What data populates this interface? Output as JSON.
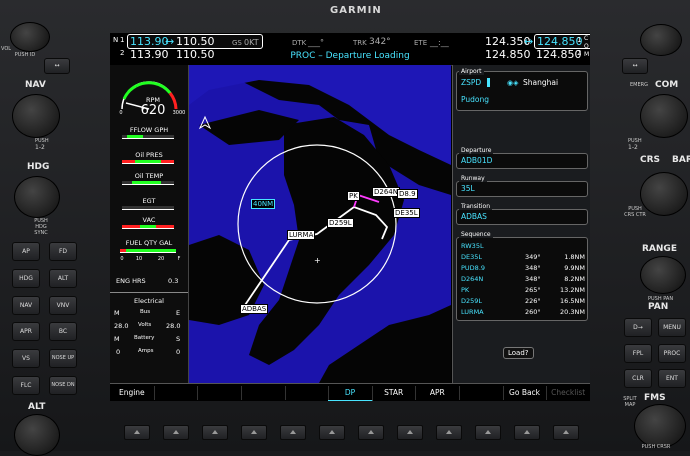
{
  "brand": "GARMIN",
  "nav": {
    "n1_label": "N",
    "n1_num": "1",
    "n2_num": "2",
    "n1_active": "113.90",
    "n1_arrow": "↔",
    "n1_standby": "110.50",
    "n2_active": "113.90",
    "n2_standby": "110.50"
  },
  "status": {
    "gs_label": "GS",
    "gs_value": "0KT",
    "dtk_label": "DTK",
    "dtk_value": "___°",
    "trk_label": "TRK",
    "trk_value": "342°",
    "ete_label": "ETE",
    "ete_value": "__:__"
  },
  "com": {
    "c1_active": "124.350",
    "c1_arrow": "↔",
    "c1_standby": "124.850",
    "c2_active": "124.850",
    "c2_standby": "124.850",
    "c1_num": "1",
    "c2_num": "2",
    "side_c": "C",
    "side_o": "O",
    "side_m": "M"
  },
  "page_title": "PROC – Departure Loading",
  "eis": {
    "rpm_label": "RPM",
    "rpm_value": "620",
    "rpm_min": "0",
    "rpm_max": "3000",
    "fflow": "FFLOW GPH",
    "oil_pres": "Oil PRES",
    "oil_temp": "Oil TEMP",
    "egt": "EGT",
    "vac": "VAC",
    "fuel_qty": "FUEL QTY GAL",
    "fuel_0": "0",
    "fuel_10": "10",
    "fuel_20": "20",
    "fuel_f": "F",
    "eng_hrs_label": "ENG HRS",
    "eng_hrs_value": "0.3",
    "electrical": "Electrical",
    "m1": "M",
    "bus": "Bus",
    "e1": "E",
    "volts_m": "28.0",
    "volts": "Volts",
    "volts_e": "28.0",
    "m2": "M",
    "battery": "Battery",
    "s": "S",
    "amps_m": "0",
    "amps": "Amps",
    "amps_s": "0"
  },
  "map": {
    "range_label": "40NM",
    "waypoints": [
      "PK",
      "D264N",
      "D8.9",
      "DE35L",
      "D259L",
      "LURMA",
      "ADBAS"
    ]
  },
  "airport": {
    "title": "Airport",
    "ident": "ZSPD",
    "city": "Shanghai",
    "name": "Pudong"
  },
  "departure": {
    "title": "Departure",
    "value": "ADB01D"
  },
  "runway": {
    "title": "Runway",
    "value": "35L"
  },
  "transition": {
    "title": "Transition",
    "value": "ADBAS"
  },
  "sequence": {
    "title": "Sequence",
    "rows": [
      {
        "wpt": "RW35L",
        "crs": "",
        "dist": ""
      },
      {
        "wpt": "DE35L",
        "crs": "349°",
        "dist": "1.8NM"
      },
      {
        "wpt": "PUD8.9",
        "crs": "348°",
        "dist": "9.9NM"
      },
      {
        "wpt": "D264N",
        "crs": "348°",
        "dist": "8.2NM"
      },
      {
        "wpt": "PK",
        "crs": "265°",
        "dist": "13.2NM"
      },
      {
        "wpt": "D259L",
        "crs": "226°",
        "dist": "16.5NM"
      },
      {
        "wpt": "LURMA",
        "crs": "260°",
        "dist": "20.3NM"
      }
    ]
  },
  "load_button": "Load?",
  "softkeys": [
    "Engine",
    "",
    "",
    "",
    "",
    "DP",
    "STAR",
    "APR",
    "",
    "Go Back",
    "Checklist"
  ],
  "left_panel": {
    "vol": "VOL",
    "push_id": "PUSH ID",
    "nav": "NAV",
    "push": "PUSH",
    "one_two": "1-2",
    "hdg": "HDG",
    "push_hdg_sync": "PUSH HDG SYNC",
    "ap": "AP",
    "fd": "FD",
    "hdg_btn": "HDG",
    "alt_btn": "ALT",
    "nav_btn": "NAV",
    "vnv": "VNV",
    "apr": "APR",
    "bc": "BC",
    "vs": "VS",
    "nose_up": "NOSE UP",
    "flc": "FLC",
    "nose_dn": "NOSE DN",
    "alt": "ALT"
  },
  "right_panel": {
    "emerg": "EMERG",
    "com": "COM",
    "push": "PUSH",
    "one_two": "1-2",
    "crs": "CRS",
    "baro": "BARO",
    "push_crs_ctr": "PUSH CRS CTR",
    "range": "RANGE",
    "push_pan": "PUSH PAN",
    "pan": "PAN",
    "direct": "D→",
    "menu": "MENU",
    "fpl": "FPL",
    "proc": "PROC",
    "clr": "CLR",
    "ent": "ENT",
    "fms": "FMS",
    "push_crsr": "PUSH CRSR",
    "split_map": "SPLIT MAP"
  }
}
